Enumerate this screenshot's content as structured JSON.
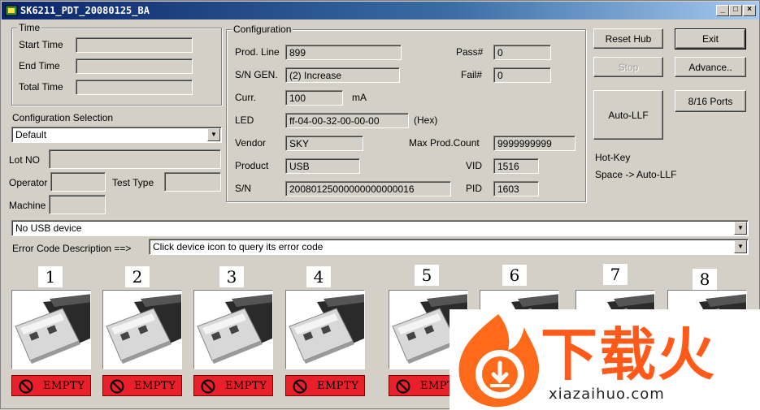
{
  "window": {
    "title": "SK6211_PDT_20080125_BA",
    "minimize": "_",
    "maximize": "□",
    "close": "×"
  },
  "time": {
    "group_label": "Time",
    "start_label": "Start Time",
    "start_value": "",
    "end_label": "End Time",
    "end_value": "",
    "total_label": "Total Time",
    "total_value": ""
  },
  "config_selection": {
    "label": "Configuration Selection",
    "selected": "Default",
    "lot_label": "Lot NO",
    "lot_value": "",
    "operator_label": "Operator",
    "operator_value": "",
    "test_type_label": "Test Type",
    "test_type_value": "",
    "machine_label": "Machine",
    "machine_value": ""
  },
  "configuration": {
    "group_label": "Configuration",
    "prod_line_label": "Prod. Line",
    "prod_line_value": "899",
    "sn_gen_label": "S/N GEN.",
    "sn_gen_value": "(2) Increase",
    "curr_label": "Curr.",
    "curr_value": "100",
    "curr_unit": "mA",
    "led_label": "LED",
    "led_value": "ff-04-00-32-00-00-00",
    "led_unit": "(Hex)",
    "vendor_label": "Vendor",
    "vendor_value": "SKY",
    "product_label": "Product",
    "product_value": "USB",
    "sn_label": "S/N",
    "sn_value": "20080125000000000000016",
    "pass_label": "Pass#",
    "pass_value": "0",
    "fail_label": "Fail#",
    "fail_value": "0",
    "max_count_label": "Max Prod.Count",
    "max_count_value": "9999999999",
    "vid_label": "VID",
    "vid_value": "1516",
    "pid_label": "PID",
    "pid_value": "1603"
  },
  "buttons": {
    "reset_hub": "Reset Hub",
    "exit": "Exit",
    "stop": "Stop",
    "advance": "Advance..",
    "auto_llf": "Auto-LLF",
    "ports": "8/16 Ports"
  },
  "hotkey": {
    "title": "Hot-Key",
    "desc": "Space -> Auto-LLF"
  },
  "device_select": "No USB device",
  "error_code": {
    "label": "Error Code Description ==>",
    "value": "Click device icon to query its error code"
  },
  "ports": [
    {
      "num": "1",
      "status": "EMPTY"
    },
    {
      "num": "2",
      "status": "EMPTY"
    },
    {
      "num": "3",
      "status": "EMPTY"
    },
    {
      "num": "4",
      "status": "EMPTY"
    },
    {
      "num": "5",
      "status": "EMPTY"
    },
    {
      "num": "6",
      "status": ""
    },
    {
      "num": "7",
      "status": ""
    },
    {
      "num": "8",
      "status": ""
    }
  ],
  "watermark": {
    "text": "下载火",
    "url": "xiazaihuo.com"
  },
  "colors": {
    "title_start": "#0a246a",
    "title_end": "#a6caf0",
    "status_red": "#e8202a",
    "watermark_orange": "#ff5a1a"
  }
}
